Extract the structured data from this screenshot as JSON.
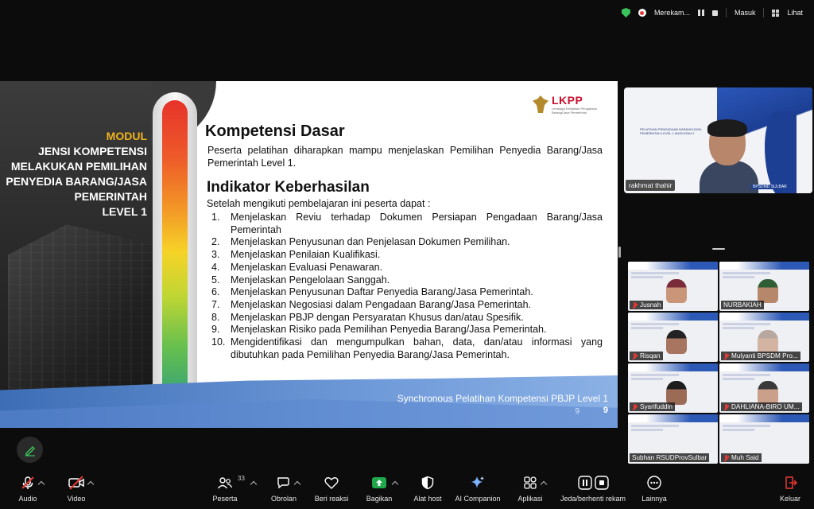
{
  "status_bar": {
    "recording_label": "Merekam...",
    "sign_in_label": "Masuk",
    "view_label": "Lihat"
  },
  "slide": {
    "module": [
      "MODUL",
      "JENSI KOMPETENSI",
      "MELAKUKAN PEMILIHAN",
      "PENYEDIA BARANG/JASA",
      "PEMERINTAH",
      "LEVEL 1"
    ],
    "logo_text": "LKPP",
    "logo_sub": "Lembaga Kebijakan Pengadaan Barang/Jasa Pemerintah",
    "heading1": "Kompetensi Dasar",
    "lead": "Peserta pelatihan diharapkan mampu menjelaskan Pemilihan Penyedia Barang/Jasa Pemerintah Level 1.",
    "heading2": "Indikator Keberhasilan",
    "intro": "Setelah mengikuti pembelajaran ini peserta dapat :",
    "items": [
      {
        "n": "1.",
        "t": "Menjelaskan Reviu terhadap Dokumen Persiapan Pengadaan Barang/Jasa Pemerintah"
      },
      {
        "n": "2.",
        "t": "Menjelaskan Penyusunan dan Penjelasan Dokumen Pemilihan."
      },
      {
        "n": "3.",
        "t": "Menjelaskan Penilaian Kualifikasi."
      },
      {
        "n": "4.",
        "t": "Menjelaskan Evaluasi Penawaran."
      },
      {
        "n": "5.",
        "t": "Menjelaskan Pengelolaan Sanggah."
      },
      {
        "n": "6.",
        "t": "Menjelaskan Penyusunan Daftar Penyedia Barang/Jasa Pemerintah."
      },
      {
        "n": "7.",
        "t": "Menjelaskan Negosiasi dalam Pengadaan Barang/Jasa Pemerintah."
      },
      {
        "n": "8.",
        "t": "Menjelaskan PBJP dengan Persyaratan Khusus dan/atau Spesifik."
      },
      {
        "n": "9.",
        "t": "Menjelaskan Risiko pada Pemilihan Penyedia Barang/Jasa Pemerintah."
      },
      {
        "n": "10.",
        "t": "Mengidentifikasi dan mengumpulkan bahan, data, dan/atau informasi yang dibutuhkan pada Pemilihan Penyedia Barang/Jasa Pemerintah."
      }
    ],
    "footer": "Synchronous Pelatihan Kompetensi PBJP Level 1",
    "page_faint": "9",
    "page": "9"
  },
  "speaker": {
    "name": "rakhmat thahir",
    "mini_title": "PELATIHAN PENGADAAN BARANG/JASA PEMERINTAH LEVEL 1 ANGKATAN 2",
    "badge": "BPSDMD SULBAR"
  },
  "gallery": [
    {
      "name": "Jusnah",
      "muted": true,
      "skin": "#c9967a",
      "hair": "#7b2c3a"
    },
    {
      "name": "NURBAKIAH",
      "muted": false,
      "skin": "#b7876b",
      "hair": "#2f5e35"
    },
    {
      "name": "Risqan",
      "muted": true,
      "skin": "#a87560",
      "hair": "#222222"
    },
    {
      "name": "Mulyanti BPSDM Pro...",
      "muted": true,
      "skin": "#d3b4a3",
      "hair": "#b8a79f"
    },
    {
      "name": "Syarifuddin",
      "muted": true,
      "skin": "#9b6b56",
      "hair": "#1d1d1d"
    },
    {
      "name": "DAHLIANA-BIRO UM...",
      "muted": true,
      "skin": "#caa08a",
      "hair": "#3a3a3a"
    },
    {
      "name": "Subhan RSUDProvSulbar",
      "muted": false,
      "skin": "#eef0f4",
      "hair": "#eef0f4"
    },
    {
      "name": "Muh Said",
      "muted": true,
      "skin": "#eef0f4",
      "hair": "#eef0f4"
    }
  ],
  "toolbar": {
    "audio": "Audio",
    "video": "Video",
    "participants": "Peserta",
    "participants_count": "33",
    "chat": "Obrolan",
    "react": "Beri reaksi",
    "share": "Bagikan",
    "host_tools": "Alat host",
    "ai_companion": "AI Companion",
    "apps": "Aplikasi",
    "pause_stop_record": "Jeda/berhenti rekam",
    "more": "Lainnya",
    "leave": "Keluar"
  }
}
